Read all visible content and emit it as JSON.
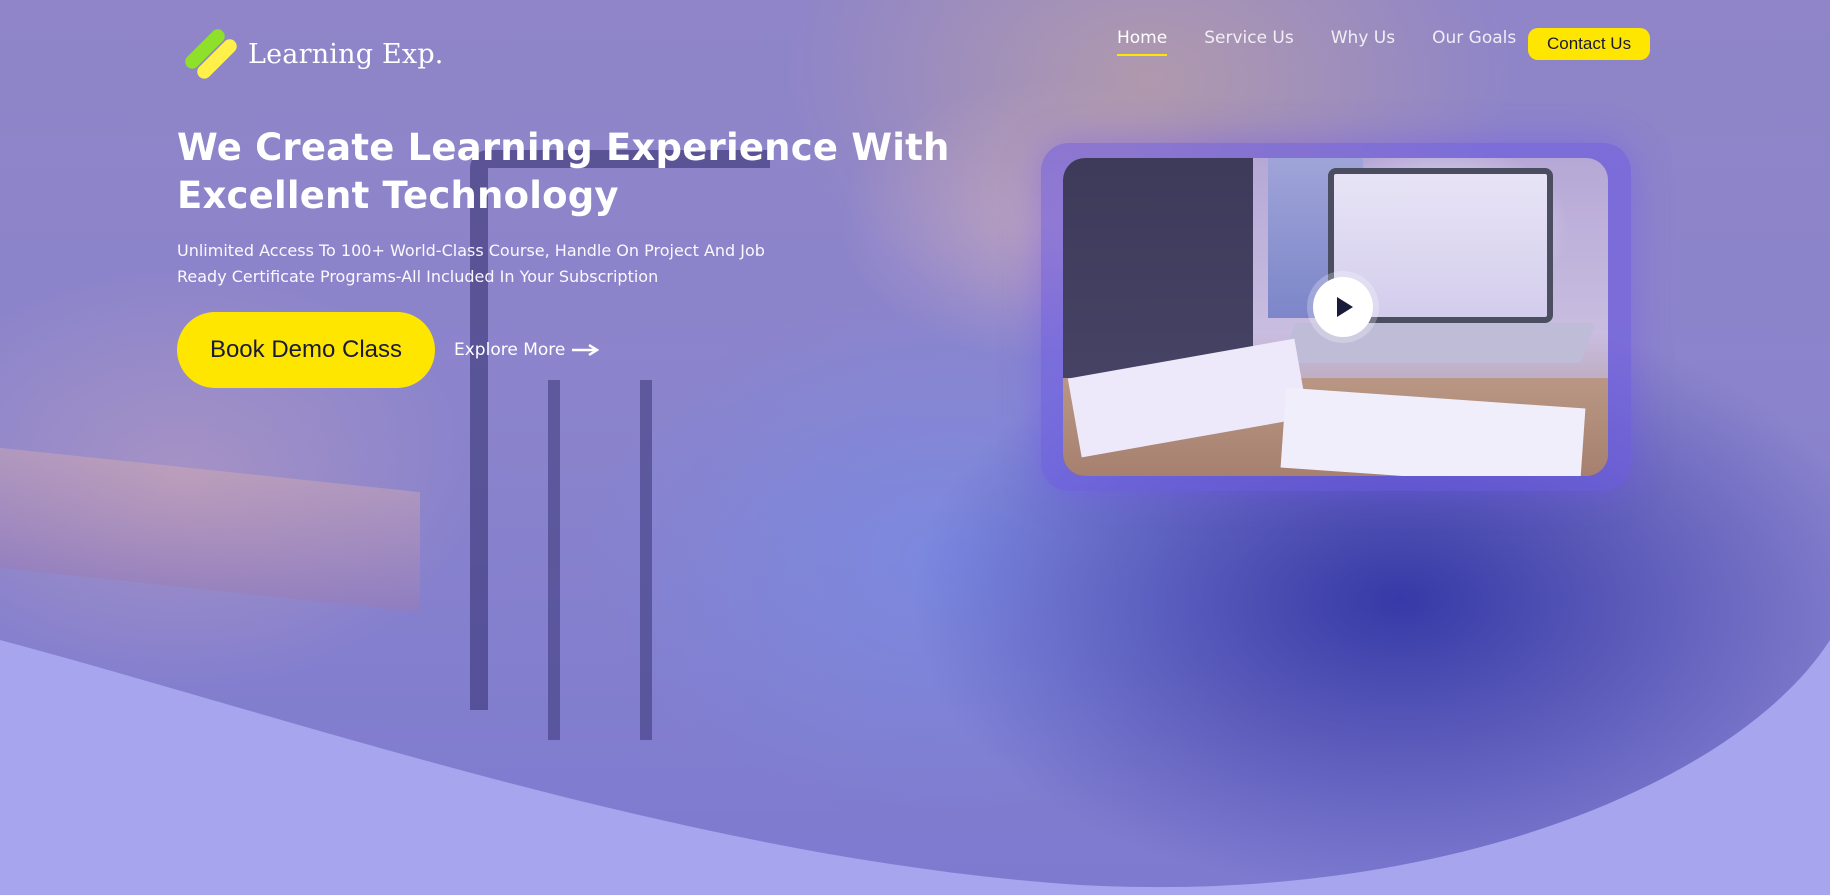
{
  "brand": {
    "name": "Learning Exp.",
    "colors": {
      "accent": "#ffe600",
      "logo_green": "#8ee02a",
      "logo_yellow": "#fff04a",
      "overlay": "#8a80c9"
    }
  },
  "nav": {
    "items": [
      {
        "label": "Home",
        "active": true
      },
      {
        "label": "Service Us",
        "active": false
      },
      {
        "label": "Why Us",
        "active": false
      },
      {
        "label": "Our Goals",
        "active": false
      }
    ],
    "contact_label": "Contact Us"
  },
  "hero": {
    "title": "We Create Learning Experience With Excellent Technology",
    "subtitle": "Unlimited Access To 100+ World-Class Course, Handle On Project And Job Ready Certificate Programs-All Included In Your Subscription",
    "primary_cta": "Book Demo Class",
    "secondary_cta": "Explore More"
  },
  "video": {
    "play_icon": "play-icon"
  }
}
